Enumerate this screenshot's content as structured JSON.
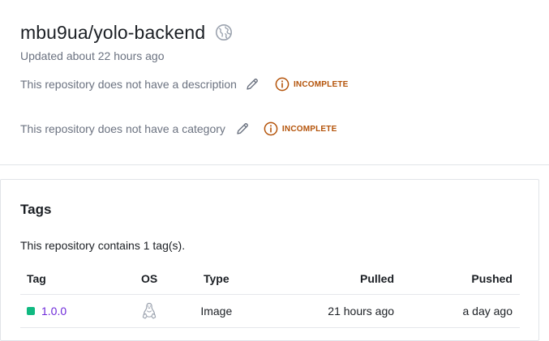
{
  "repo": {
    "name": "mbu9ua/yolo-backend",
    "updated": "Updated about 22 hours ago",
    "visibility_icon": "public-globe-icon",
    "description_text": "This repository does not have a description",
    "category_text": "This repository does not have a category",
    "status_label": "INCOMPLETE"
  },
  "tags": {
    "title": "Tags",
    "summary": "This repository contains 1 tag(s).",
    "columns": {
      "tag": "Tag",
      "os": "OS",
      "type": "Type",
      "pulled": "Pulled",
      "pushed": "Pushed"
    },
    "rows": [
      {
        "tag": "1.0.0",
        "os_icon": "linux-icon",
        "type": "Image",
        "pulled": "21 hours ago",
        "pushed": "a day ago"
      }
    ]
  },
  "colors": {
    "incomplete": "#b45309",
    "tag_link": "#6d28d9",
    "tag_dot": "#10b981"
  }
}
